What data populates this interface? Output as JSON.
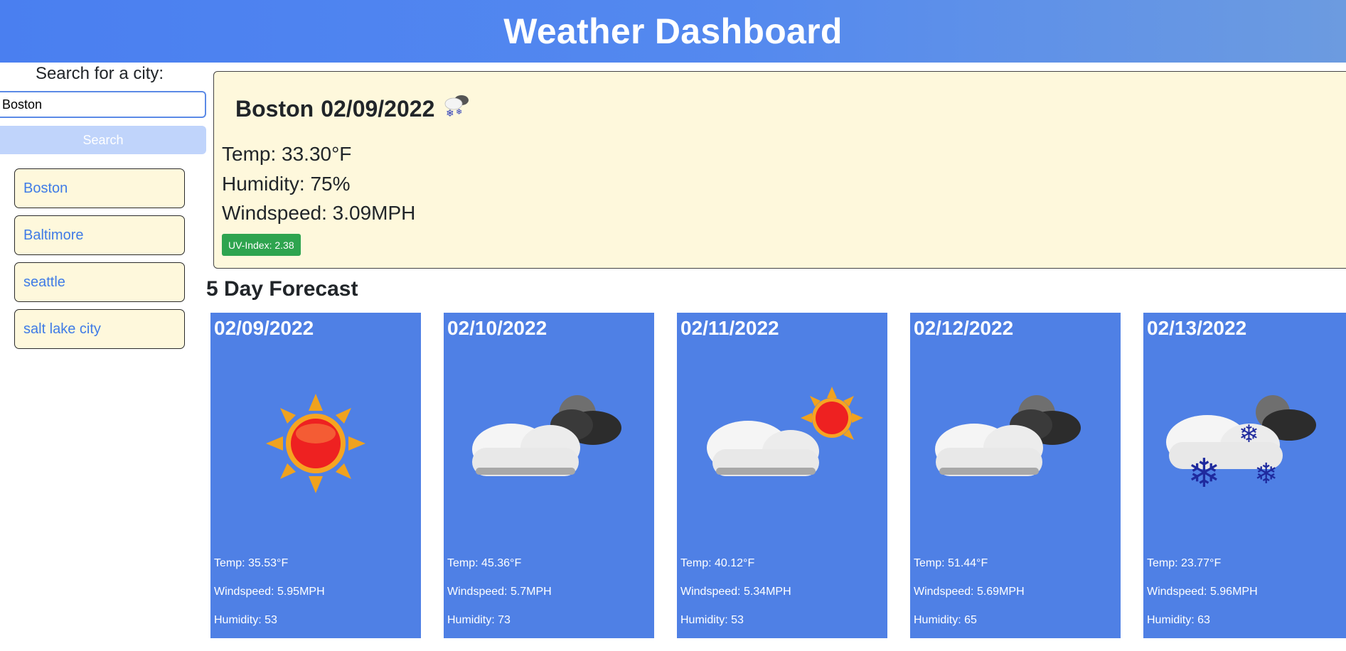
{
  "header": {
    "title": "Weather Dashboard"
  },
  "search": {
    "label": "Search for a city:",
    "value": "Boston",
    "placeholder": "",
    "button_label": "Search"
  },
  "history": [
    {
      "label": "Boston"
    },
    {
      "label": "Baltimore"
    },
    {
      "label": "seattle"
    },
    {
      "label": "salt lake city"
    }
  ],
  "current": {
    "city": "Boston",
    "date": "02/09/2022",
    "icon": "snow-cloud-icon",
    "temp": "Temp: 33.30°F",
    "humidity": "Humidity: 75%",
    "windspeed": "Windspeed: 3.09MPH",
    "uv": "UV-Index: 2.38"
  },
  "forecast_title": "5 Day Forecast",
  "forecast": [
    {
      "date": "02/09/2022",
      "icon": "sun-icon",
      "temp": "Temp: 35.53°F",
      "wind": "Windspeed: 5.95MPH",
      "humidity": "Humidity: 53"
    },
    {
      "date": "02/10/2022",
      "icon": "night-cloud-icon",
      "temp": "Temp: 45.36°F",
      "wind": "Windspeed: 5.7MPH",
      "humidity": "Humidity: 73"
    },
    {
      "date": "02/11/2022",
      "icon": "partly-sunny-icon",
      "temp": "Temp: 40.12°F",
      "wind": "Windspeed: 5.34MPH",
      "humidity": "Humidity: 53"
    },
    {
      "date": "02/12/2022",
      "icon": "night-cloud-icon",
      "temp": "Temp: 51.44°F",
      "wind": "Windspeed: 5.69MPH",
      "humidity": "Humidity: 65"
    },
    {
      "date": "02/13/2022",
      "icon": "snow-cloud-icon",
      "temp": "Temp: 23.77°F",
      "wind": "Windspeed: 5.96MPH",
      "humidity": "Humidity: 63"
    }
  ],
  "colors": {
    "header": "#4a7ff0",
    "card": "#4f80e5",
    "panel": "#fef8dc",
    "uv": "#2ea44f",
    "link": "#3f7be6"
  }
}
